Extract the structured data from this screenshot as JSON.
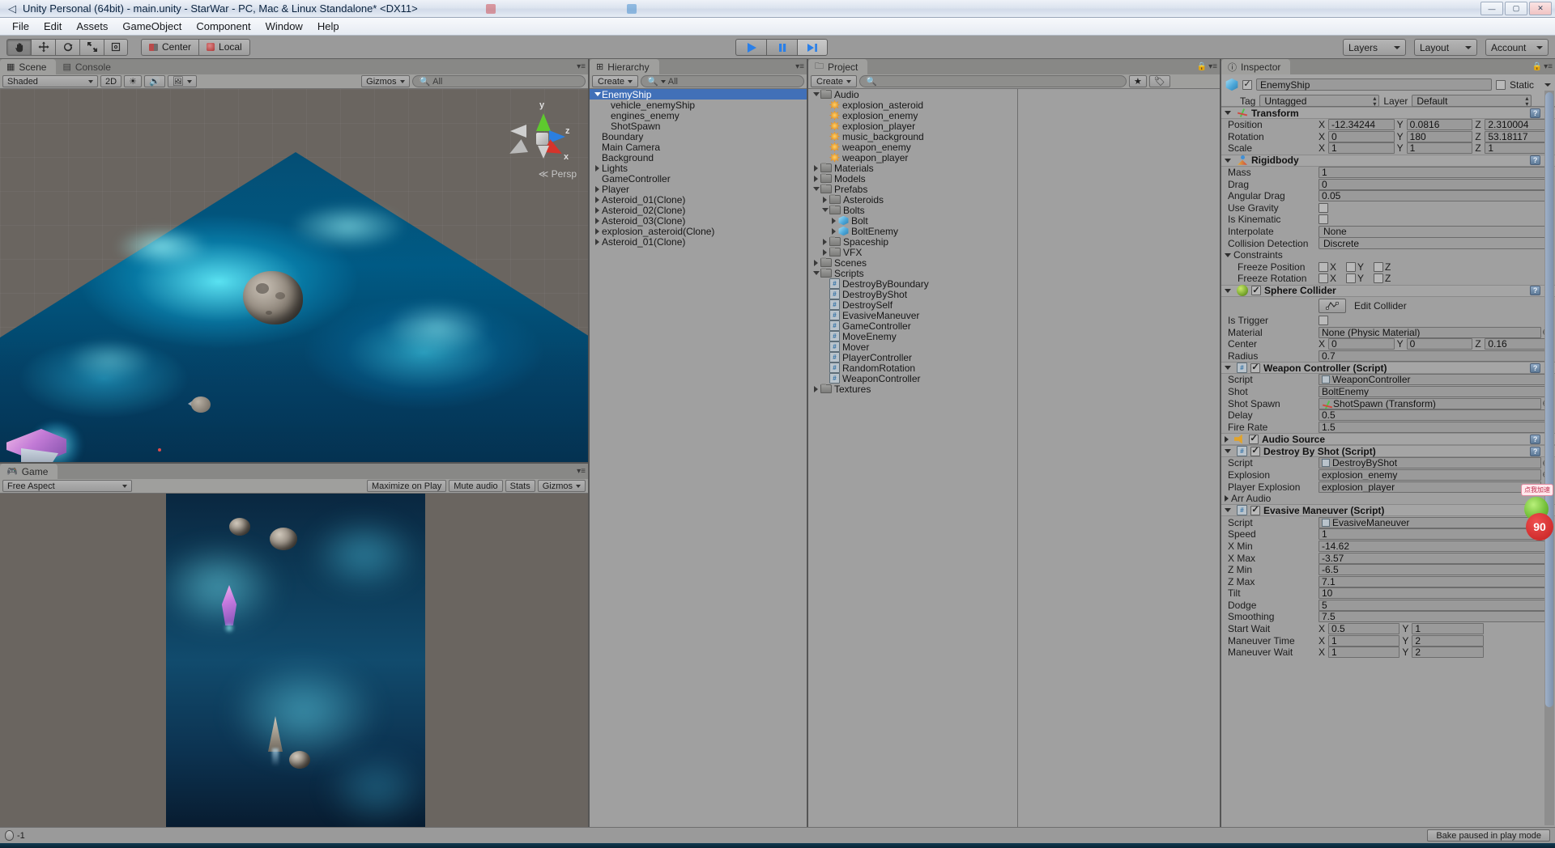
{
  "window": {
    "title": "Unity Personal (64bit) - main.unity - StarWar - PC, Mac & Linux Standalone* <DX11>",
    "minimize_label": "—",
    "maximize_label": "▢",
    "close_label": "✕"
  },
  "menu": {
    "items": [
      "File",
      "Edit",
      "Assets",
      "GameObject",
      "Component",
      "Window",
      "Help"
    ]
  },
  "toolbar": {
    "tools": [
      {
        "name": "hand-tool",
        "glyph": "✋",
        "active": true
      },
      {
        "name": "move-tool",
        "glyph": "✥",
        "active": false
      },
      {
        "name": "rotate-tool",
        "glyph": "⟳",
        "active": false
      },
      {
        "name": "scale-tool",
        "glyph": "⤡",
        "active": false
      },
      {
        "name": "rect-tool",
        "glyph": "⬚",
        "active": false
      }
    ],
    "pivot_mode": "Center",
    "pivot_rotation": "Local",
    "play": "▶",
    "pause": "❚❚",
    "step": "▶❚",
    "layers": "Layers",
    "layout": "Layout",
    "account": "Account"
  },
  "scene": {
    "tab_label": "Scene",
    "console_tab_label": "Console",
    "shading_mode": "Shaded",
    "two_d": "2D",
    "gizmos": "Gizmos",
    "search_placeholder": "All",
    "gizmo": {
      "y_label": "y",
      "x_label": "x",
      "z_label": "z",
      "projection": "Persp"
    }
  },
  "game": {
    "tab_label": "Game",
    "aspect": "Free Aspect",
    "maximize_on_play": "Maximize on Play",
    "mute_audio": "Mute audio",
    "stats": "Stats",
    "gizmos": "Gizmos"
  },
  "hierarchy": {
    "tab_label": "Hierarchy",
    "create_label": "Create",
    "search_placeholder": "All",
    "items": [
      {
        "label": "EnemyShip",
        "depth": 0,
        "arrow": "down",
        "selected": true
      },
      {
        "label": "vehicle_enemyShip",
        "depth": 1,
        "arrow": "none",
        "selected": false
      },
      {
        "label": "engines_enemy",
        "depth": 1,
        "arrow": "none",
        "selected": false
      },
      {
        "label": "ShotSpawn",
        "depth": 1,
        "arrow": "none",
        "selected": false
      },
      {
        "label": "Boundary",
        "depth": 0,
        "arrow": "none",
        "selected": false
      },
      {
        "label": "Main Camera",
        "depth": 0,
        "arrow": "none",
        "selected": false
      },
      {
        "label": "Background",
        "depth": 0,
        "arrow": "none",
        "selected": false
      },
      {
        "label": "Lights",
        "depth": 0,
        "arrow": "right",
        "selected": false
      },
      {
        "label": "GameController",
        "depth": 0,
        "arrow": "none",
        "selected": false
      },
      {
        "label": "Player",
        "depth": 0,
        "arrow": "right",
        "selected": false
      },
      {
        "label": "Asteroid_01(Clone)",
        "depth": 0,
        "arrow": "right",
        "selected": false
      },
      {
        "label": "Asteroid_02(Clone)",
        "depth": 0,
        "arrow": "right",
        "selected": false
      },
      {
        "label": "Asteroid_03(Clone)",
        "depth": 0,
        "arrow": "right",
        "selected": false
      },
      {
        "label": "explosion_asteroid(Clone)",
        "depth": 0,
        "arrow": "right",
        "selected": false
      },
      {
        "label": "Asteroid_01(Clone)",
        "depth": 0,
        "arrow": "right",
        "selected": false
      }
    ]
  },
  "project": {
    "tab_label": "Project",
    "create_label": "Create",
    "search_placeholder": "",
    "items": [
      {
        "label": "Audio",
        "depth": 0,
        "arrow": "down",
        "icon": "folder"
      },
      {
        "label": "explosion_asteroid",
        "depth": 1,
        "arrow": "none",
        "icon": "audio"
      },
      {
        "label": "explosion_enemy",
        "depth": 1,
        "arrow": "none",
        "icon": "audio"
      },
      {
        "label": "explosion_player",
        "depth": 1,
        "arrow": "none",
        "icon": "audio"
      },
      {
        "label": "music_background",
        "depth": 1,
        "arrow": "none",
        "icon": "audio"
      },
      {
        "label": "weapon_enemy",
        "depth": 1,
        "arrow": "none",
        "icon": "audio"
      },
      {
        "label": "weapon_player",
        "depth": 1,
        "arrow": "none",
        "icon": "audio"
      },
      {
        "label": "Materials",
        "depth": 0,
        "arrow": "right",
        "icon": "folder"
      },
      {
        "label": "Models",
        "depth": 0,
        "arrow": "right",
        "icon": "folder"
      },
      {
        "label": "Prefabs",
        "depth": 0,
        "arrow": "down",
        "icon": "folder"
      },
      {
        "label": "Asteroids",
        "depth": 1,
        "arrow": "right",
        "icon": "folder"
      },
      {
        "label": "Bolts",
        "depth": 1,
        "arrow": "down",
        "icon": "folder"
      },
      {
        "label": "Bolt",
        "depth": 2,
        "arrow": "right",
        "icon": "cube"
      },
      {
        "label": "BoltEnemy",
        "depth": 2,
        "arrow": "right",
        "icon": "cube"
      },
      {
        "label": "Spaceship",
        "depth": 1,
        "arrow": "right",
        "icon": "folder"
      },
      {
        "label": "VFX",
        "depth": 1,
        "arrow": "right",
        "icon": "folder"
      },
      {
        "label": "Scenes",
        "depth": 0,
        "arrow": "right",
        "icon": "folder"
      },
      {
        "label": "Scripts",
        "depth": 0,
        "arrow": "down",
        "icon": "folder"
      },
      {
        "label": "DestroyByBoundary",
        "depth": 1,
        "arrow": "none",
        "icon": "cs"
      },
      {
        "label": "DestroyByShot",
        "depth": 1,
        "arrow": "none",
        "icon": "cs"
      },
      {
        "label": "DestroySelf",
        "depth": 1,
        "arrow": "none",
        "icon": "cs"
      },
      {
        "label": "EvasiveManeuver",
        "depth": 1,
        "arrow": "none",
        "icon": "cs"
      },
      {
        "label": "GameController",
        "depth": 1,
        "arrow": "none",
        "icon": "cs"
      },
      {
        "label": "MoveEnemy",
        "depth": 1,
        "arrow": "none",
        "icon": "cs"
      },
      {
        "label": "Mover",
        "depth": 1,
        "arrow": "none",
        "icon": "cs"
      },
      {
        "label": "PlayerController",
        "depth": 1,
        "arrow": "none",
        "icon": "cs"
      },
      {
        "label": "RandomRotation",
        "depth": 1,
        "arrow": "none",
        "icon": "cs"
      },
      {
        "label": "WeaponController",
        "depth": 1,
        "arrow": "none",
        "icon": "cs"
      },
      {
        "label": "Textures",
        "depth": 0,
        "arrow": "right",
        "icon": "folder"
      }
    ]
  },
  "inspector": {
    "tab_label": "Inspector",
    "object_name": "EnemyShip",
    "static_label": "Static",
    "tag_label": "Tag",
    "tag_value": "Untagged",
    "layer_label": "Layer",
    "layer_value": "Default",
    "transform": {
      "title": "Transform",
      "position_label": "Position",
      "position": {
        "x": "-12.34244",
        "y": "0.0816",
        "z": "2.310004"
      },
      "rotation_label": "Rotation",
      "rotation": {
        "x": "0",
        "y": "180",
        "z": "53.18117"
      },
      "scale_label": "Scale",
      "scale": {
        "x": "1",
        "y": "1",
        "z": "1"
      }
    },
    "rigidbody": {
      "title": "Rigidbody",
      "mass_label": "Mass",
      "mass": "1",
      "drag_label": "Drag",
      "drag": "0",
      "angular_drag_label": "Angular Drag",
      "angular_drag": "0.05",
      "use_gravity_label": "Use Gravity",
      "use_gravity": false,
      "is_kinematic_label": "Is Kinematic",
      "is_kinematic": false,
      "interpolate_label": "Interpolate",
      "interpolate": "None",
      "collision_detection_label": "Collision Detection",
      "collision_detection": "Discrete",
      "constraints_label": "Constraints",
      "freeze_position_label": "Freeze Position",
      "freeze_rotation_label": "Freeze Rotation",
      "axis_x": "X",
      "axis_y": "Y",
      "axis_z": "Z"
    },
    "sphere_collider": {
      "title": "Sphere Collider",
      "edit_collider_label": "Edit Collider",
      "is_trigger_label": "Is Trigger",
      "is_trigger": false,
      "material_label": "Material",
      "material": "None (Physic Material)",
      "center_label": "Center",
      "center": {
        "x": "0",
        "y": "0",
        "z": "0.16"
      },
      "radius_label": "Radius",
      "radius": "0.7"
    },
    "weapon_controller": {
      "title": "Weapon Controller (Script)",
      "script_label": "Script",
      "script": "WeaponController",
      "shot_label": "Shot",
      "shot": "BoltEnemy",
      "shot_spawn_label": "Shot Spawn",
      "shot_spawn": "ShotSpawn (Transform)",
      "delay_label": "Delay",
      "delay": "0.5",
      "fire_rate_label": "Fire Rate",
      "fire_rate": "1.5"
    },
    "audio_source": {
      "title": "Audio Source"
    },
    "destroy_by_shot": {
      "title": "Destroy By Shot (Script)",
      "script_label": "Script",
      "script": "DestroyByShot",
      "explosion_label": "Explosion",
      "explosion": "explosion_enemy",
      "player_explosion_label": "Player Explosion",
      "player_explosion": "explosion_player",
      "arr_audio_label": "Arr Audio"
    },
    "evasive_maneuver": {
      "title": "Evasive Maneuver (Script)",
      "script_label": "Script",
      "script": "EvasiveManeuver",
      "speed_label": "Speed",
      "speed": "1",
      "x_min_label": "X Min",
      "x_min": "-14.62",
      "x_max_label": "X Max",
      "x_max": "-3.57",
      "z_min_label": "Z Min",
      "z_min": "-6.5",
      "z_max_label": "Z Max",
      "z_max": "7.1",
      "tilt_label": "Tilt",
      "tilt": "10",
      "dodge_label": "Dodge",
      "dodge": "5",
      "smoothing_label": "Smoothing",
      "smoothing": "7.5",
      "start_wait_label": "Start Wait",
      "start_wait": {
        "x": "0.5",
        "y": "1"
      },
      "maneuver_time_label": "Maneuver Time",
      "maneuver_time": {
        "x": "1",
        "y": "2"
      },
      "maneuver_wait_label": "Maneuver Wait",
      "maneuver_wait": {
        "x": "1",
        "y": "2"
      }
    }
  },
  "overlay": {
    "badge_text": "90",
    "tip_text": "点我加速"
  },
  "status": {
    "message": "-1",
    "bake_label": "Bake paused in play mode"
  },
  "colors": {
    "selection_blue": "#4170b8",
    "panel_gray": "#a0a0a0",
    "chrome_gray": "#9a9a9a",
    "accent_cyan": "#78f5ff"
  }
}
